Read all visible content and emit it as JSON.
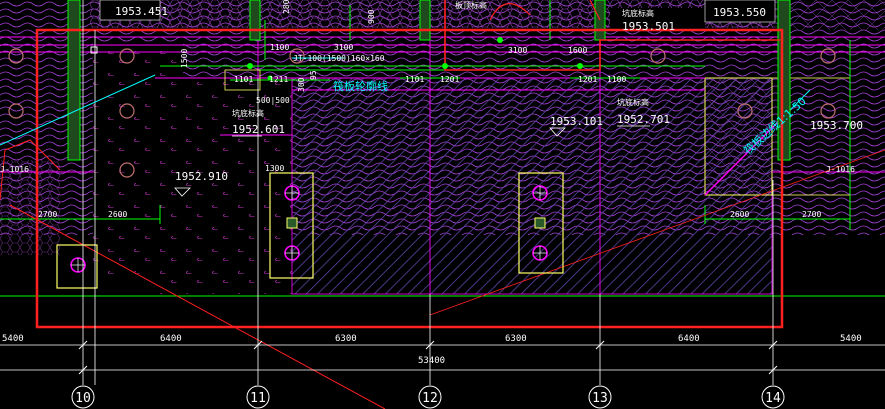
{
  "drawing": {
    "background": "#000000",
    "colors": {
      "red": "#ff2020",
      "green": "#00ff00",
      "magenta": "#ff00ff",
      "yellow": "#ffff66",
      "cyan": "#00ffff",
      "white": "#ffffff",
      "hatch": "#6a4fb0"
    }
  },
  "elevations": {
    "e1953451": "1953.451",
    "e1953501": "1953.501",
    "e1953550": "1953.550",
    "e1952601": "1952.601",
    "e1952910": "1952.910",
    "e1953101": "1953.101",
    "e1952701": "1952.701",
    "e1953700": "1953.700"
  },
  "dims": {
    "d1100a": "1100",
    "d3100a": "3100",
    "d3100b": "3100",
    "d1600": "1600",
    "d1101a": "1101",
    "d1211": "1211",
    "d500500": "500|500",
    "d1101b": "1101",
    "d1201a": "1201",
    "d1201b": "1201",
    "d1100b": "1100",
    "d1300": "1300",
    "d2700a": "2700",
    "d2600a": "2600",
    "d2600b": "2600",
    "d2700b": "2700",
    "v1500": "1500",
    "v300": "300",
    "v95": "95",
    "v900": "900",
    "v280": "280"
  },
  "bottom_dims": {
    "s5400a": "5400",
    "s6400a": "6400",
    "s6300a": "6300",
    "s6300b": "6300",
    "s6400b": "6400",
    "s5400b": "5400",
    "total": "53400"
  },
  "notes": {
    "top_green": "板顶标高",
    "raft_label_left": "坑底标高",
    "raft_label_right": "坑底标高",
    "top_note_right": "坑底标高",
    "small_green_left": "J-1016",
    "small_green_right": "J-1016",
    "plate_tag": "JT-100(1500)160×160"
  },
  "cyan_texts": {
    "raft_outline": "筏板轮廓线",
    "raft_edge": "筏板边线1:1.50"
  },
  "axes": [
    "10",
    "11",
    "12",
    "13",
    "14"
  ]
}
